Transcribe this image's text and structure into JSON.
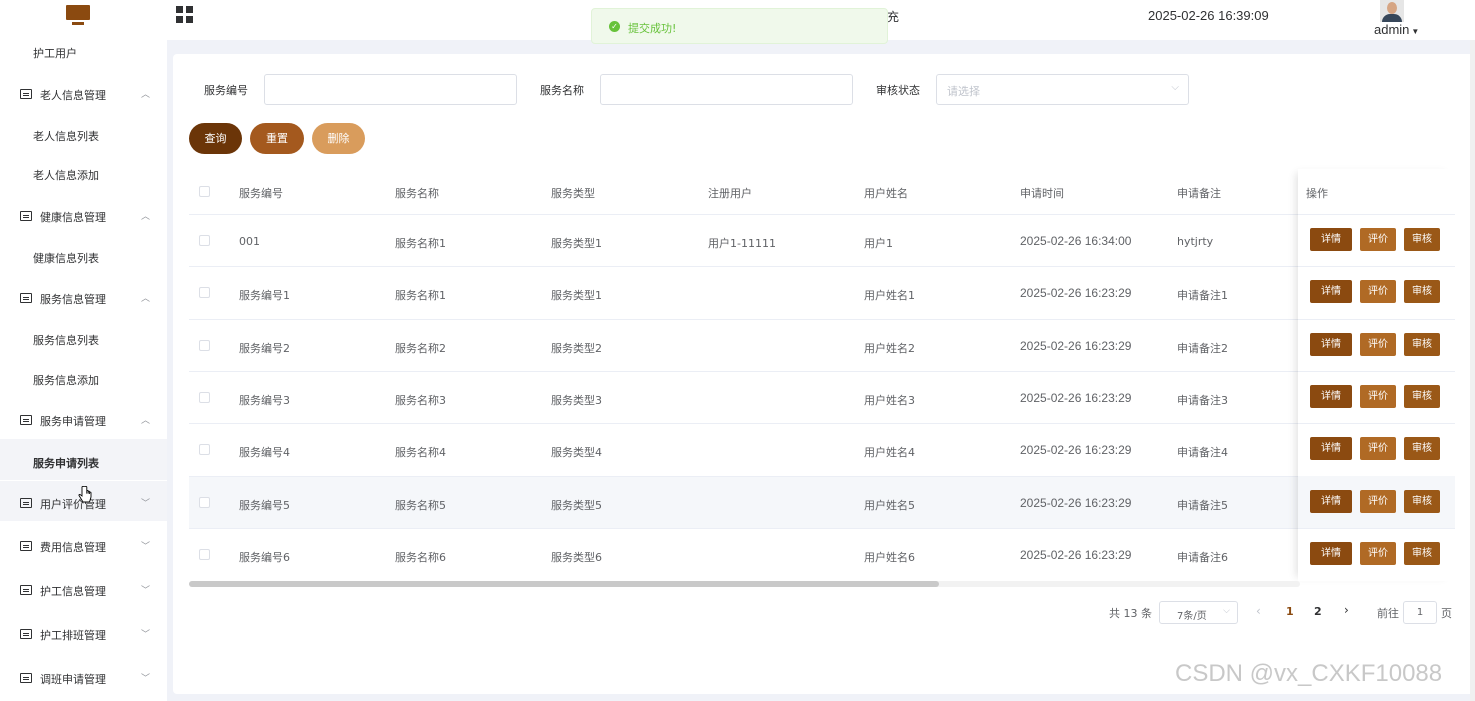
{
  "header": {
    "cut_text": "充",
    "datetime": "2025-02-26 16:39:09",
    "user": "admin",
    "icons": [
      "monitor-logo-icon",
      "grid-menu-icon",
      "avatar",
      "chevron-down-icon"
    ]
  },
  "toast": {
    "message": "提交成功!",
    "type": "success"
  },
  "sidebar": {
    "items": [
      {
        "type": "sub",
        "label": "护工用户"
      },
      {
        "type": "group",
        "label": "老人信息管理",
        "expanded": true
      },
      {
        "type": "sub",
        "label": "老人信息列表"
      },
      {
        "type": "sub",
        "label": "老人信息添加"
      },
      {
        "type": "group",
        "label": "健康信息管理",
        "expanded": true
      },
      {
        "type": "sub",
        "label": "健康信息列表"
      },
      {
        "type": "group",
        "label": "服务信息管理",
        "expanded": true
      },
      {
        "type": "sub",
        "label": "服务信息列表"
      },
      {
        "type": "sub",
        "label": "服务信息添加"
      },
      {
        "type": "group",
        "label": "服务申请管理",
        "expanded": true
      },
      {
        "type": "sub",
        "label": "服务申请列表",
        "active": true
      },
      {
        "type": "group",
        "label": "用户评价管理",
        "expanded": false
      },
      {
        "type": "group",
        "label": "费用信息管理",
        "expanded": false
      },
      {
        "type": "group",
        "label": "护工信息管理",
        "expanded": false
      },
      {
        "type": "group",
        "label": "护工排班管理",
        "expanded": false
      },
      {
        "type": "group",
        "label": "调班申请管理",
        "expanded": false
      }
    ]
  },
  "filters": {
    "service_no_label": "服务编号",
    "service_name_label": "服务名称",
    "audit_status_label": "审核状态",
    "audit_status_placeholder": "请选择"
  },
  "actions": {
    "query": "查询",
    "reset": "重置",
    "delete": "删除"
  },
  "table": {
    "columns": [
      "服务编号",
      "服务名称",
      "服务类型",
      "注册用户",
      "用户姓名",
      "申请时间",
      "申请备注",
      "操作"
    ],
    "rows": [
      [
        "001",
        "服务名称1",
        "服务类型1",
        "用户1-11111",
        "用户1",
        "2025-02-26 16:34:00",
        "hytjrty"
      ],
      [
        "服务编号1",
        "服务名称1",
        "服务类型1",
        "",
        "用户姓名1",
        "2025-02-26 16:23:29",
        "申请备注1"
      ],
      [
        "服务编号2",
        "服务名称2",
        "服务类型2",
        "",
        "用户姓名2",
        "2025-02-26 16:23:29",
        "申请备注2"
      ],
      [
        "服务编号3",
        "服务名称3",
        "服务类型3",
        "",
        "用户姓名3",
        "2025-02-26 16:23:29",
        "申请备注3"
      ],
      [
        "服务编号4",
        "服务名称4",
        "服务类型4",
        "",
        "用户姓名4",
        "2025-02-26 16:23:29",
        "申请备注4"
      ],
      [
        "服务编号5",
        "服务名称5",
        "服务类型5",
        "",
        "用户姓名5",
        "2025-02-26 16:23:29",
        "申请备注5"
      ],
      [
        "服务编号6",
        "服务名称6",
        "服务类型6",
        "",
        "用户姓名6",
        "2025-02-26 16:23:29",
        "申请备注6"
      ]
    ],
    "row_actions": {
      "detail": "详情",
      "review": "评价",
      "audit": "审核"
    }
  },
  "pagination": {
    "total": "共 13 条",
    "page_size": "7条/页",
    "pages": [
      "1",
      "2"
    ],
    "current_page": "1",
    "goto_label": "前往",
    "goto_value": "1",
    "page_suffix": "页"
  },
  "watermark": "CSDN @vx_CXKF10088",
  "colors": {
    "primary": "#8b4a10",
    "btn_query": "#6b3508",
    "btn_reset": "#a4591e",
    "btn_delete": "#d99c5c",
    "op_detail": "#8b4a10",
    "op_review": "#b06a25",
    "op_audit": "#9a5817",
    "success": "#67c23a"
  }
}
